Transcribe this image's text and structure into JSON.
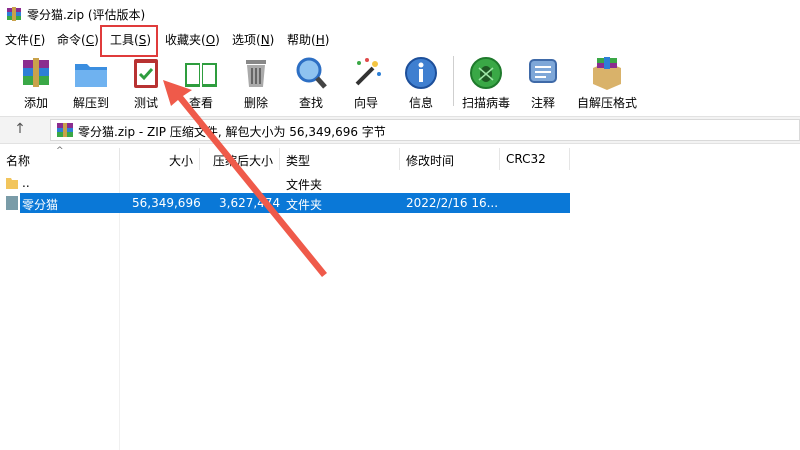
{
  "window": {
    "title": "零分猫.zip (评估版本)"
  },
  "menu": {
    "items": [
      {
        "label": "文件(",
        "key": "F",
        "end": ")"
      },
      {
        "label": "命令(",
        "key": "C",
        "end": ")"
      },
      {
        "label": "工具(",
        "key": "S",
        "end": ")"
      },
      {
        "label": "收藏夹(",
        "key": "O",
        "end": ")"
      },
      {
        "label": "选项(",
        "key": "N",
        "end": ")"
      },
      {
        "label": "帮助(",
        "key": "H",
        "end": ")"
      }
    ]
  },
  "toolbar": {
    "items": [
      {
        "label": "添加",
        "icon": "add-archive-icon"
      },
      {
        "label": "解压到",
        "icon": "extract-folder-icon"
      },
      {
        "label": "测试",
        "icon": "test-clipboard-icon"
      },
      {
        "label": "查看",
        "icon": "view-book-icon"
      },
      {
        "label": "删除",
        "icon": "trash-icon"
      },
      {
        "label": "查找",
        "icon": "magnifier-icon"
      },
      {
        "label": "向导",
        "icon": "wizard-wand-icon"
      },
      {
        "label": "信息",
        "icon": "info-icon"
      },
      {
        "label": "扫描病毒",
        "icon": "virus-scan-icon"
      },
      {
        "label": "注释",
        "icon": "comment-icon"
      },
      {
        "label": "自解压格式",
        "icon": "sfx-box-icon"
      }
    ]
  },
  "address": {
    "path": "零分猫.zip - ZIP 压缩文件, 解包大小为 56,349,696 字节"
  },
  "columns": {
    "name": "名称",
    "size": "大小",
    "packed": "压缩后大小",
    "type": "类型",
    "modified": "修改时间",
    "crc": "CRC32"
  },
  "rows": [
    {
      "name": "..",
      "size": "",
      "packed": "",
      "type": "文件夹",
      "modified": ""
    },
    {
      "name": "零分猫",
      "size": "56,349,696",
      "packed": "3,627,474",
      "type": "文件夹",
      "modified": "2022/2/16 16..."
    }
  ],
  "colors": {
    "selection": "#0a78d7",
    "highlight": "#e03b3b",
    "arrow": "#ef5a4a"
  }
}
